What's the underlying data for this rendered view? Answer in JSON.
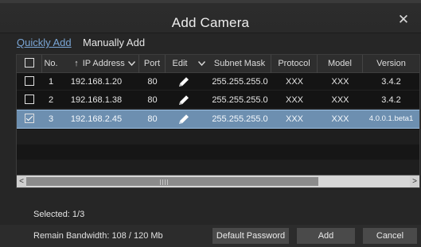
{
  "dialog": {
    "title": "Add Camera"
  },
  "tabs": {
    "quick": "Quickly Add",
    "manual": "Manually Add"
  },
  "table": {
    "headers": {
      "no": "No.",
      "ip": "IP Address",
      "port": "Port",
      "edit": "Edit",
      "mask": "Subnet Mask",
      "protocol": "Protocol",
      "model": "Model",
      "version": "Version"
    },
    "rows": [
      {
        "no": "1",
        "ip": "192.168.1.20",
        "port": "80",
        "mask": "255.255.255.0",
        "protocol": "XXX",
        "model": "XXX",
        "version": "3.4.2",
        "checked": false
      },
      {
        "no": "2",
        "ip": "192.168.1.38",
        "port": "80",
        "mask": "255.255.255.0",
        "protocol": "XXX",
        "model": "XXX",
        "version": "3.4.2",
        "checked": false
      },
      {
        "no": "3",
        "ip": "192.168.2.45",
        "port": "80",
        "mask": "255.255.255.0",
        "protocol": "XXX",
        "model": "XXX",
        "version": "4.0.0.1.beta1",
        "checked": true
      }
    ]
  },
  "status": {
    "selected": "Selected: 1/3"
  },
  "footer": {
    "bandwidth": "Remain Bandwidth: 108 / 120 Mb",
    "default_password": "Default Password",
    "add": "Add",
    "cancel": "Cancel"
  },
  "colors": {
    "selected_row": "#6d8fb0",
    "link_tab": "#7aa6d6"
  },
  "icons": {
    "close": "close-icon",
    "sort": "sort-arrow-icon",
    "pencil": "pencil-icon",
    "dropdown": "chevron-down-icon"
  }
}
